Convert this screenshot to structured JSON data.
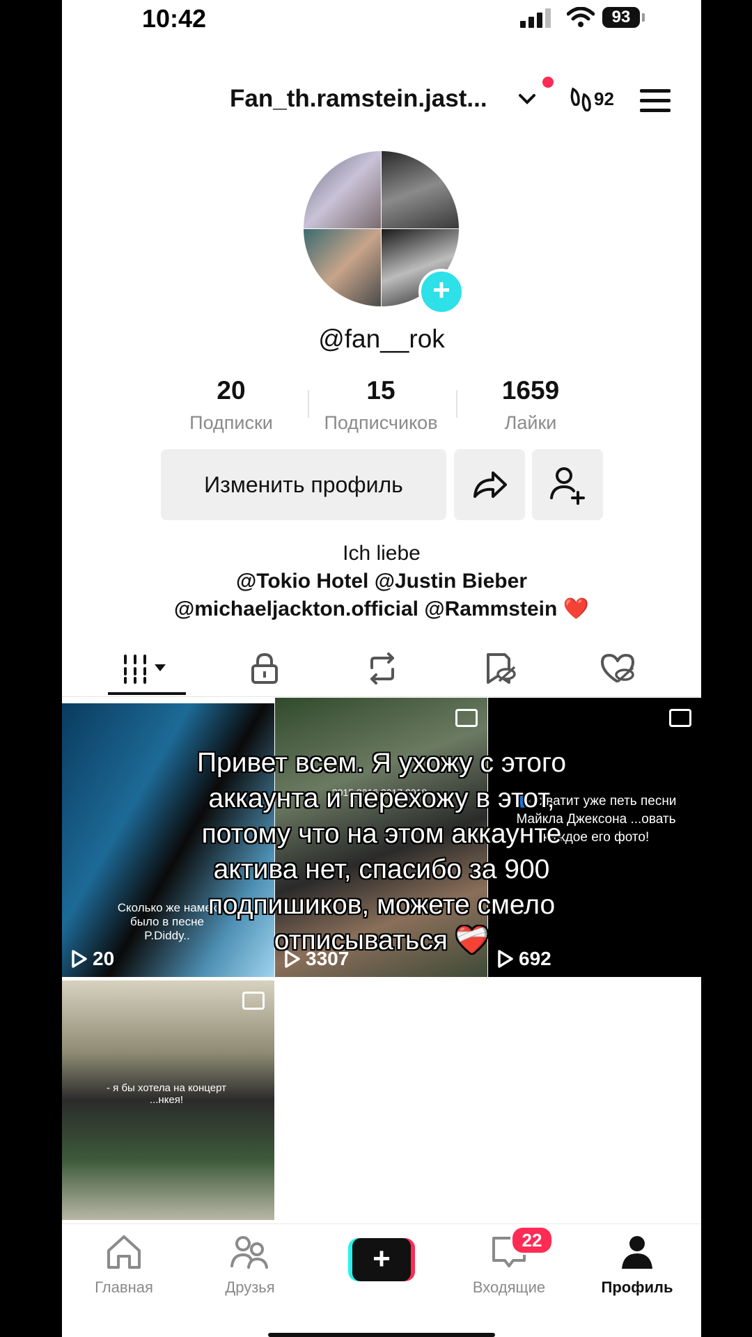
{
  "status_bar": {
    "time": "10:42",
    "battery": "93"
  },
  "header": {
    "username": "Fan_th.ramstein.jast...",
    "stats_badge": "92"
  },
  "profile": {
    "handle": "@fan__rok"
  },
  "stats": [
    {
      "value": "20",
      "label": "Подписки"
    },
    {
      "value": "15",
      "label": "Подписчиков"
    },
    {
      "value": "1659",
      "label": "Лайки"
    }
  ],
  "actions": {
    "edit_label": "Изменить профиль"
  },
  "bio": {
    "line1": "Ich liebe",
    "line2": "@Tokio Hotel @Justin Bieber",
    "line3": "@michaeljackton.official @Rammstein ❤️"
  },
  "grid": {
    "videos": [
      {
        "views": "20",
        "caption": "Сколько же намек\nбыло в песне P.Diddy.."
      },
      {
        "views": "3307",
        "caption": "2015,2016,2017,2018"
      },
      {
        "views": "692",
        "caption": "🗣️: хватит уже петь песни Майкла Джексона ...овать каждое его фото!"
      },
      {
        "views": "",
        "caption": "- я бы хотела на концерт ...нкея!"
      }
    ]
  },
  "overlay_text": "Привет всем. Я ухожу с этого аккаунта и перехожу в этот, потому что на этом аккаунте актива нет, спасибо за 900 подпишиков, можете смело отписываться ❤️‍🩹",
  "nav": {
    "home": "Главная",
    "friends": "Друзья",
    "create": "+",
    "inbox": "Входящие",
    "inbox_badge": "22",
    "profile": "Профиль"
  }
}
